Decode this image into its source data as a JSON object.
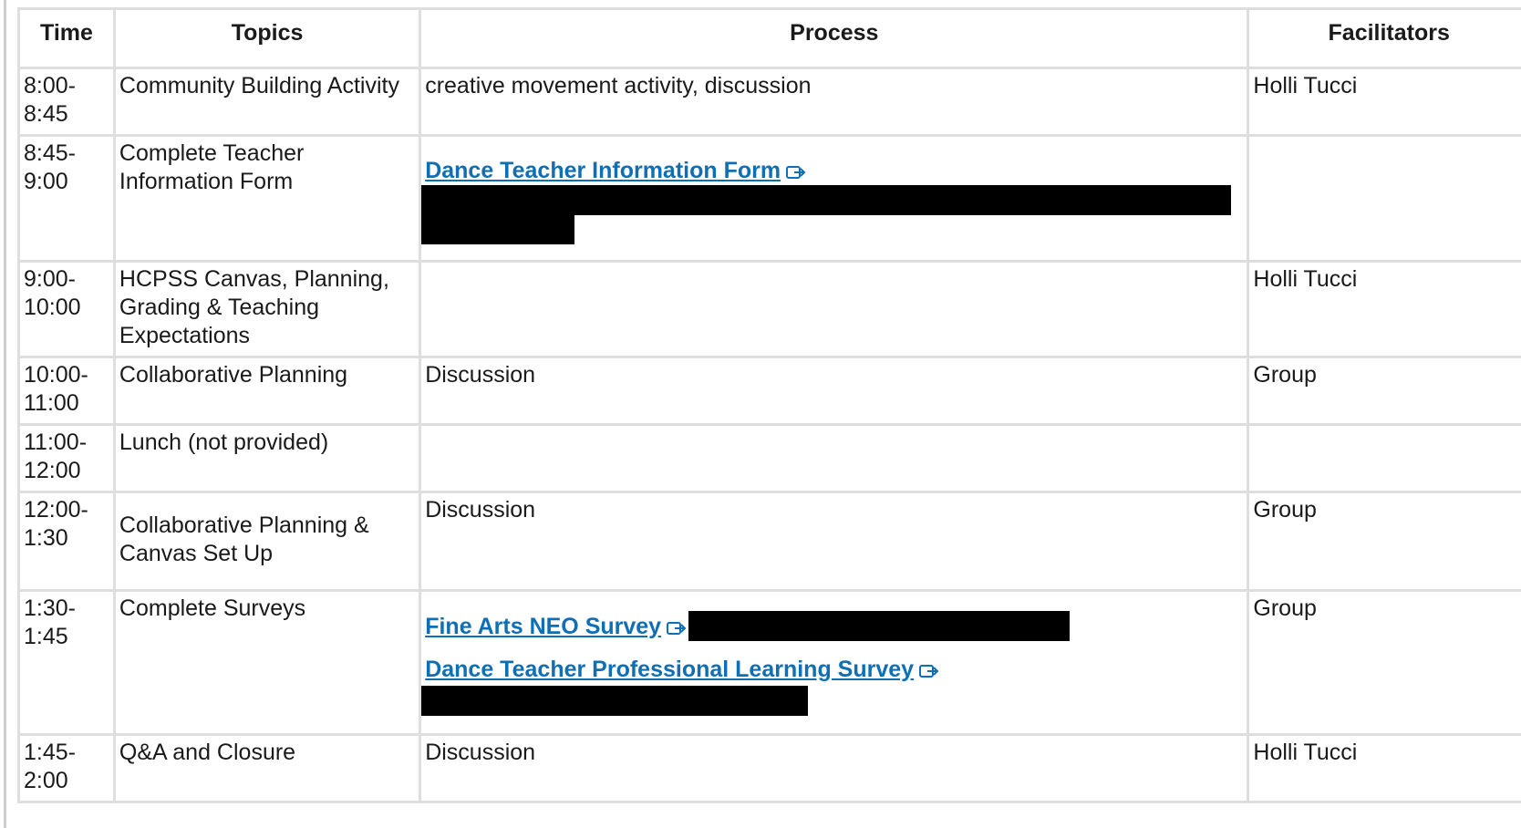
{
  "table": {
    "headers": {
      "time": "Time",
      "topics": "Topics",
      "process": "Process",
      "facilitators": "Facilitators"
    },
    "rows": [
      {
        "time": "8:00-\n8:45",
        "topic": "Community Building Activity",
        "process": "creative movement activity, discussion",
        "facilitator": "Holli Tucci"
      },
      {
        "time": "8:45-\n9:00",
        "topic": "Complete Teacher Information Form",
        "process_link": "Dance Teacher Information Form",
        "facilitator": ""
      },
      {
        "time": "9:00-\n10:00",
        "topic": "HCPSS Canvas, Planning, Grading & Teaching Expectations",
        "process": "",
        "facilitator": "Holli Tucci"
      },
      {
        "time": "10:00-\n11:00",
        "topic": "Collaborative Planning",
        "process": "Discussion",
        "facilitator": "Group"
      },
      {
        "time": "11:00-\n12:00",
        "topic": "Lunch (not provided)",
        "process": "",
        "facilitator": ""
      },
      {
        "time": "12:00-\n1:30",
        "topic": "Collaborative Planning & Canvas Set Up",
        "process": "Discussion",
        "facilitator": "Group"
      },
      {
        "time": "1:30-\n1:45",
        "topic": "Complete Surveys",
        "process_link_1": "Fine Arts NEO Survey",
        "process_link_2": "Dance Teacher Professional Learning Survey",
        "facilitator": "Group"
      },
      {
        "time": "1:45-\n2:00",
        "topic": "Q&A and Closure",
        "process": "Discussion",
        "facilitator": "Holli Tucci"
      }
    ]
  },
  "icons": {
    "external_link": "external-link-icon"
  },
  "colors": {
    "link": "#0f6fb5",
    "border": "#dedede",
    "redaction": "#000000"
  }
}
